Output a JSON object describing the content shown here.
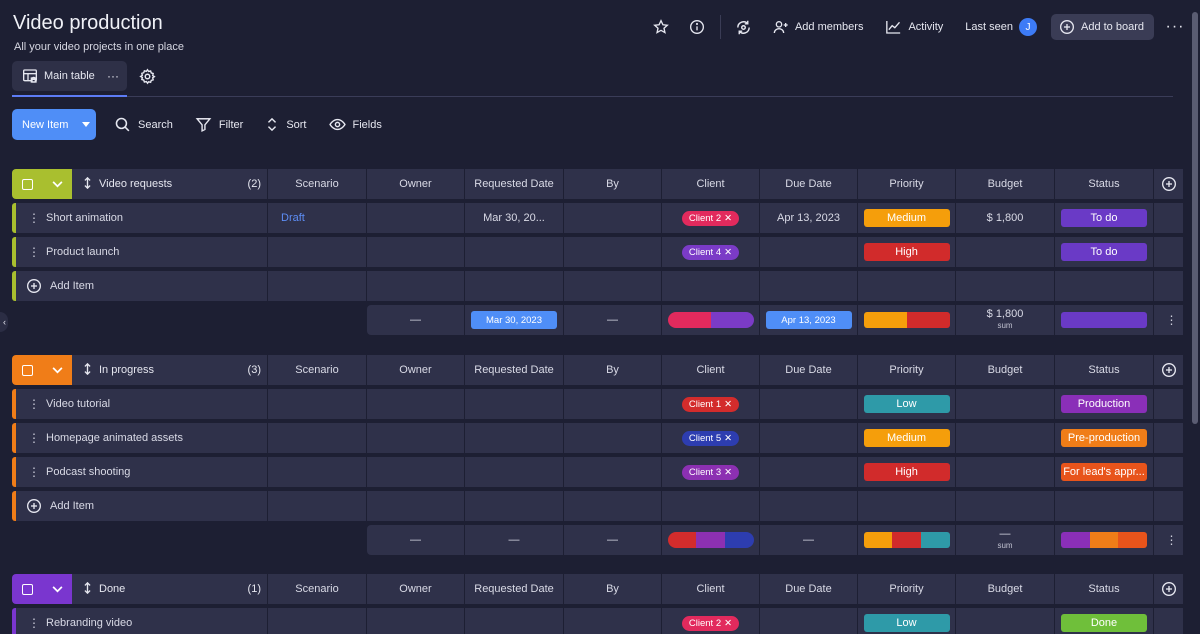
{
  "app": {
    "title": "Video production",
    "subtitle": "All your video projects in one place"
  },
  "header_actions": {
    "add_members": "Add members",
    "activity": "Activity",
    "last_seen": "Last seen",
    "avatar_initial": "J",
    "add_to_board": "Add to board"
  },
  "view": {
    "tab_label": "Main table",
    "tab_more": "···"
  },
  "toolbar": {
    "new_item": "New Item",
    "search": "Search",
    "filter": "Filter",
    "sort": "Sort",
    "fields": "Fields"
  },
  "columns": [
    "Scenario",
    "Owner",
    "Requested Date",
    "By",
    "Client",
    "Due Date",
    "Priority",
    "Budget",
    "Status"
  ],
  "colors": {
    "medium": "#f59e0b",
    "high": "#d12b2b",
    "low": "#2e9aa8",
    "todo": "#6a3ac6",
    "production": "#8a2fb8",
    "preproduction": "#f07d18",
    "forleads": "#e8541b",
    "done": "#6fbf3a",
    "client2": "#e22a5d",
    "client4": "#7b3bc7",
    "client1": "#d32c2c",
    "client5": "#2d3db0",
    "client3": "#8c30b2",
    "group_video": "#a9bf2f",
    "group_progress": "#f07d18",
    "group_done": "#7a36cf"
  },
  "groups": [
    {
      "name": "Video requests",
      "count": "(2)",
      "color": "#a9bf2f",
      "items": [
        {
          "name": "Short animation",
          "scenario": "Draft",
          "requested": "Mar 30, 20...",
          "client": "Client 2",
          "client_color": "#e22a5d",
          "due": "Apr 13, 2023",
          "priority": "Medium",
          "priority_color": "#f59e0b",
          "budget": "$ 1,800",
          "status": "To do",
          "status_color": "#6a3ac6"
        },
        {
          "name": "Product launch",
          "scenario": "",
          "requested": "",
          "client": "Client 4",
          "client_color": "#7b3bc7",
          "due": "",
          "priority": "High",
          "priority_color": "#d12b2b",
          "budget": "",
          "status": "To do",
          "status_color": "#6a3ac6"
        }
      ],
      "add_item": "Add Item",
      "summary": {
        "owner": "—",
        "requested": "Mar 30, 2023",
        "by": "—",
        "due": "Apr 13, 2023",
        "budget": "$ 1,800",
        "budget_label": "sum"
      }
    },
    {
      "name": "In progress",
      "count": "(3)",
      "color": "#f07d18",
      "items": [
        {
          "name": "Video tutorial",
          "client": "Client 1",
          "client_color": "#d32c2c",
          "priority": "Low",
          "priority_color": "#2e9aa8",
          "status": "Production",
          "status_color": "#8a2fb8"
        },
        {
          "name": "Homepage animated assets",
          "client": "Client 5",
          "client_color": "#2d3db0",
          "priority": "Medium",
          "priority_color": "#f59e0b",
          "status": "Pre-production",
          "status_color": "#f07d18"
        },
        {
          "name": "Podcast shooting",
          "client": "Client 3",
          "client_color": "#8c30b2",
          "priority": "High",
          "priority_color": "#d12b2b",
          "status": "For lead's appr...",
          "status_color": "#e8541b"
        }
      ],
      "add_item": "Add Item",
      "summary": {
        "owner": "—",
        "requested": "—",
        "by": "—",
        "due": "—",
        "budget": "—",
        "budget_label": "sum"
      }
    },
    {
      "name": "Done",
      "count": "(1)",
      "color": "#7a36cf",
      "items": [
        {
          "name": "Rebranding video",
          "client": "Client 2",
          "client_color": "#e22a5d",
          "priority": "Low",
          "priority_color": "#2e9aa8",
          "status": "Done",
          "status_color": "#6fbf3a"
        }
      ]
    }
  ]
}
